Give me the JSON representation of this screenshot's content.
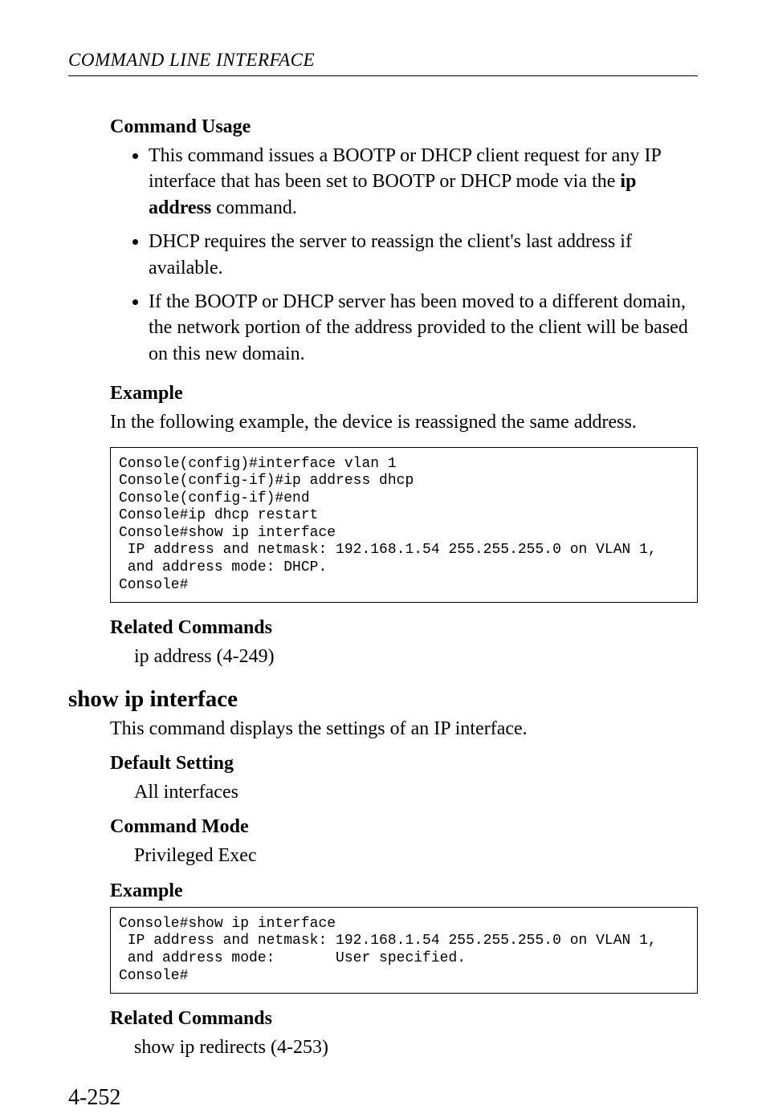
{
  "running_head": "COMMAND LINE INTERFACE",
  "section1": {
    "heading": "Command Usage",
    "bullets": [
      {
        "pre": "This command issues a BOOTP or DHCP client request for any IP interface that has been set to BOOTP or DHCP mode via the ",
        "bold1": "ip address",
        "post": " command."
      },
      {
        "text": "DHCP requires the server to reassign the client's last address if available."
      },
      {
        "text": "If the BOOTP or DHCP server has been moved to a different domain, the network portion of the address provided to the client will be based on this new domain."
      }
    ]
  },
  "section2": {
    "heading": "Example",
    "para": "In the following example, the device is reassigned the same address.",
    "code": "Console(config)#interface vlan 1\nConsole(config-if)#ip address dhcp\nConsole(config-if)#end\nConsole#ip dhcp restart\nConsole#show ip interface\n IP address and netmask: 192.168.1.54 255.255.255.0 on VLAN 1,\n and address mode: DHCP.\nConsole#"
  },
  "section3": {
    "heading": "Related Commands",
    "line": "ip address (4-249)"
  },
  "cmd_heading": "show ip interface",
  "cmd_desc": "This command displays the settings of an IP interface.",
  "section4": {
    "heading": "Default Setting",
    "line": "All interfaces"
  },
  "section5": {
    "heading": "Command Mode",
    "line": "Privileged Exec"
  },
  "section6": {
    "heading": "Example",
    "code": "Console#show ip interface\n IP address and netmask: 192.168.1.54 255.255.255.0 on VLAN 1,\n and address mode:       User specified.\nConsole#"
  },
  "section7": {
    "heading": "Related Commands",
    "line": "show ip redirects (4-253)"
  },
  "pagenum": "4-252"
}
